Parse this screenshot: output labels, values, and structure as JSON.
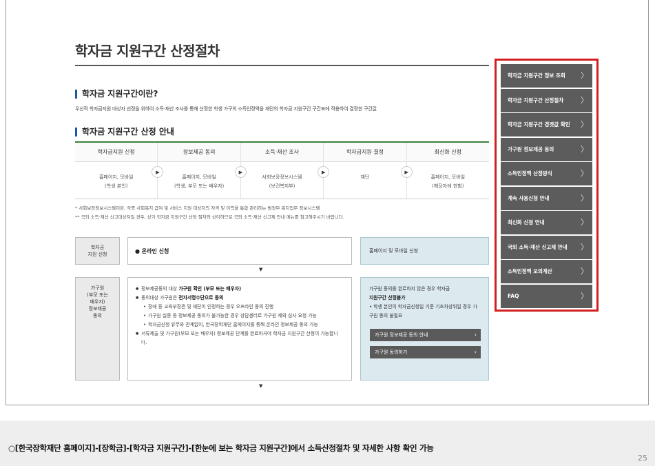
{
  "page": {
    "title": "학자금 지원구간 산정절차",
    "section1": {
      "heading": "학자금 지원구간이란?",
      "description": "우선적 학자금지원 대상자 선정을 위하여 소득·재산 조사를 통해 산정한 학생 가구의 소득인정액을 재단의 학자금 지원구간 구간표에 적용하여 결정한 구간값"
    },
    "section2": {
      "heading": "학자금 지원구간 산정 안내",
      "steps": [
        {
          "title": "학자금지원 신청",
          "body": "홈페이지, 모바일\n(학생 본인)"
        },
        {
          "title": "정보제공 동의",
          "body": "홈페이지, 모바일\n(학생, 부모 또는 배우자)"
        },
        {
          "title": "소득·재산 조사",
          "body": "사회보장정보시스템\n(보건복지부)"
        },
        {
          "title": "학자금지원 결정",
          "body": "재단"
        },
        {
          "title": "최신화 신청",
          "body": "홈페이지, 모바일\n(해당자에 한함)"
        }
      ],
      "note1": "* 사회보장정보시스템이란, 각종 사회복지 급여 및 서비스 지원 대상자의 자격 및 이력을 통합 관리하는 범정부 복지업무 정보시스템",
      "note2": "** 국외 소득·재산 신고대상자일 경우, 상기 학자금 지원구간 산정 절차와 상이하므로 국외 소득·재산 신고제 안내 메뉴를 참고해주시기 바랍니다."
    },
    "flow": {
      "apply_label": "학자금\n지원 신청",
      "apply_content": "● 온라인 신청",
      "apply_right": "홈페이지 및 모바일 신청",
      "household_label": "가구원\n(부모 또는\n배우자)\n정보제공\n동의",
      "detail": {
        "l1_pre": "정보제공동의 대상 ",
        "l1_bold": "가구원 확인 (부모 또는 배우자)",
        "l2_pre": "동의대상 가구원은 ",
        "l2_bold": "전자서명수단으로 동의",
        "s1": "장애 등 교육부장관 및 재단이 인정하는 경우 오프라인 동의 진행",
        "s2": "가구원 실종 등 정보제공 동의가 불가능한 경우 상담센터로 가구원 제외 심사 요청 가능",
        "s3": "학자금신청 유무와 관계없이, 한국장학재단 홈페이지를 통해 온라인 정보제공 동의 가능",
        "l3": "서류제출 및 가구원(부모 또는 배우자) 정보제공 단계를 완료하셔야 학자금 지원구간 산정이 가능합니다."
      },
      "side": {
        "line1": "가구원 동의를 완료하지 않은 경우 학자금",
        "line2_bold": "지원구간 산정불가",
        "line3": "• 학생 본인이 학자금신청일 기준 기초차상위일 경우 가구원 동의 불필요",
        "btn1": "가구원 정보제공 동의 안내",
        "btn2": "가구원 동의하기"
      }
    },
    "menu": [
      "학자금 지원구간 정보 조회",
      "학자금 지원구간 산정절차",
      "학자금 지원구간 경곗값 확인",
      "가구원 정보제공 동의",
      "소득인정액 산정방식",
      "계속 사용신청 안내",
      "최신화 신청 안내",
      "국외 소득·재산 신고제 안내",
      "소득인정액 모의계산",
      "FAQ"
    ],
    "caption": "○[한국장학재단 홈페이지]-[장학금]-[학자금 지원구간]-[한눈에 보는 학자금 지원구간]에서 소득산정절차 및 자세한 사항 확인 가능",
    "page_number": "25",
    "accent_color": "#d21f1f"
  }
}
